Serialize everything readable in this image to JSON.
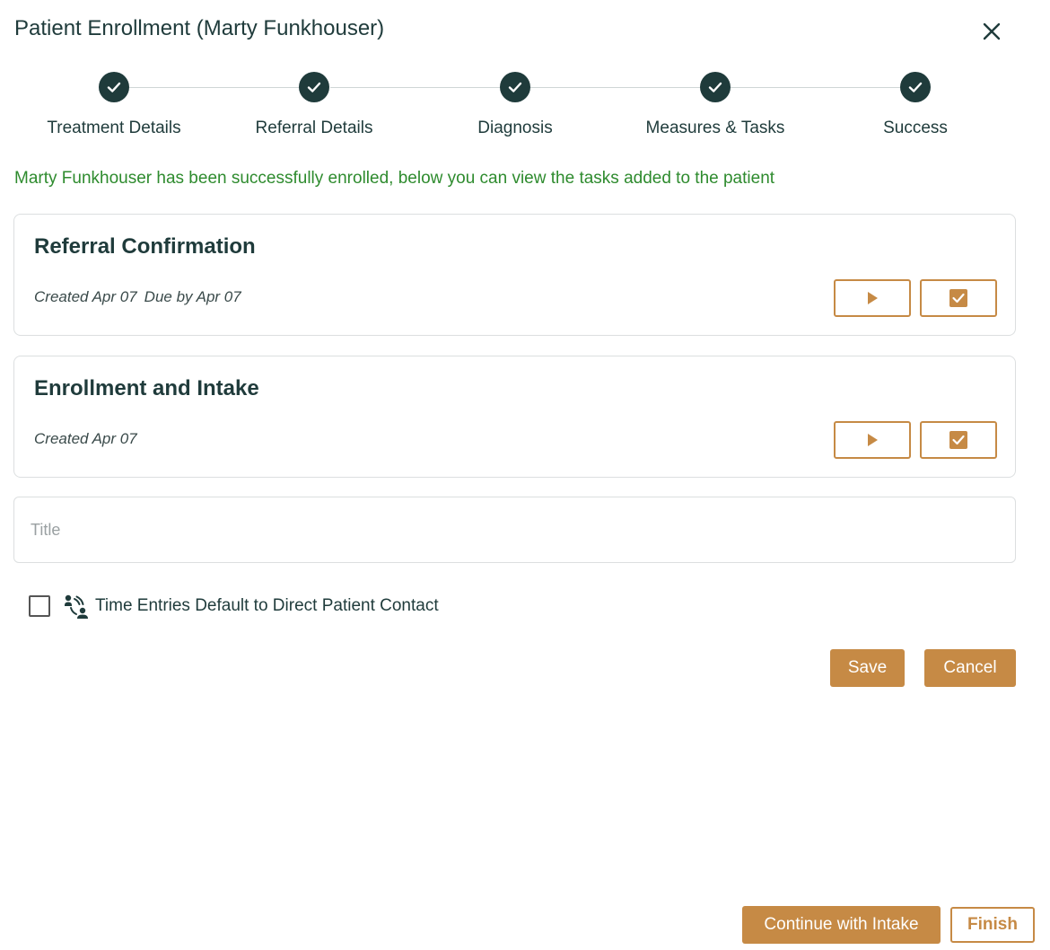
{
  "modal": {
    "title": "Patient Enrollment (Marty Funkhouser)",
    "close_icon": "close-icon"
  },
  "steps": [
    {
      "label": "Treatment Details",
      "status": "complete"
    },
    {
      "label": "Referral Details",
      "status": "complete"
    },
    {
      "label": "Diagnosis",
      "status": "complete"
    },
    {
      "label": "Measures & Tasks",
      "status": "complete"
    },
    {
      "label": "Success",
      "status": "complete"
    }
  ],
  "success_message": "Marty Funkhouser has been successfully enrolled, below you can view the tasks added to the patient",
  "tasks": [
    {
      "title": "Referral Confirmation",
      "created": "Created Apr 07",
      "due": "Due by Apr 07"
    },
    {
      "title": "Enrollment and Intake",
      "created": "Created Apr 07",
      "due": ""
    }
  ],
  "task_form": {
    "title_placeholder": "Title",
    "title_value": "",
    "direct_contact_label": "Time Entries Default to Direct Patient Contact",
    "direct_contact_checked": false,
    "save_label": "Save",
    "cancel_label": "Cancel"
  },
  "footer": {
    "continue_label": "Continue with Intake",
    "finish_label": "Finish"
  },
  "colors": {
    "primary_dark": "#1f3b3b",
    "accent": "#c68a45",
    "success": "#2e8b2e",
    "border": "#dcdfe0"
  }
}
